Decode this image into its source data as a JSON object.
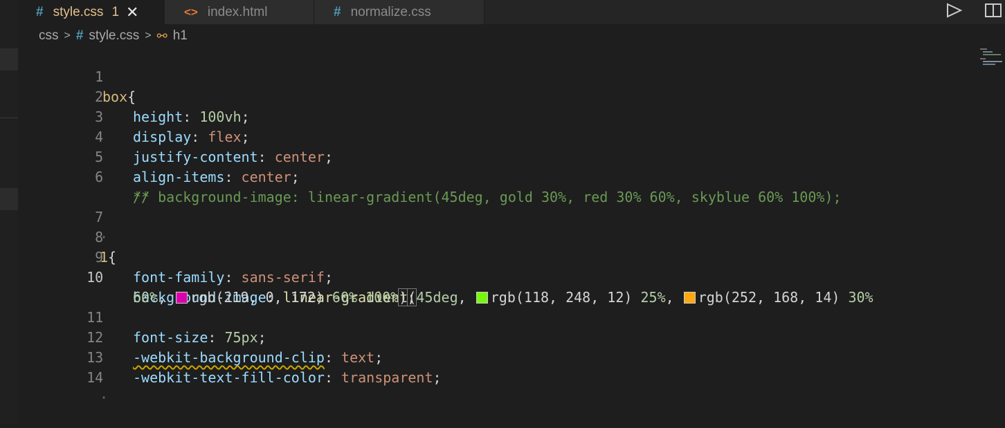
{
  "tabs": [
    {
      "icon": "#",
      "label": "style.css",
      "badge": "1",
      "close": "✕",
      "active": true
    },
    {
      "icon": "<>",
      "label": "index.html"
    },
    {
      "icon": "#",
      "label": "normalize.css"
    }
  ],
  "breadcrumb": {
    "folder": "css",
    "sep": ">",
    "file_icon": "#",
    "file": "style.css",
    "symbol_icon": "⚯",
    "symbol": "h1"
  },
  "lines": {
    "l1": "1",
    "l2": "2",
    "l3": "3",
    "l4": "4",
    "l5": "5",
    "l6": "6",
    "l7": "7",
    "l8": "8",
    "l9": "9",
    "l10": "10",
    "l11": "11",
    "l12": "12",
    "l13": "13",
    "l14": "14"
  },
  "code": {
    "l1_sel": "box",
    "l1_brace": "{",
    "l2_prop": "height",
    "l2_val": "100vh",
    "l3_prop": "display",
    "l3_val": "flex",
    "l4_prop": "justify-content",
    "l4_val": "center",
    "l5_prop": "align-items",
    "l5_val": "center",
    "l6_comment": "/* background-image: linear-gradient(45deg, gold 30%, red 30% 60%, skyblue 60% 100%);",
    "l6_cont": "*/",
    "l7_dot": "·",
    "l8_sel": "1",
    "l8_brace": "{",
    "l9_prop": "font-family",
    "l9_val": "sans-serif",
    "l10_prop": "background-image",
    "l10_fn": "linear-gradient",
    "l10_deg": "45deg",
    "l10_c1": "rgb(118, 248, 12)",
    "l10_p1": "25%",
    "l10_c2": "rgb(252, 168, 14)",
    "l10_p2": "30%",
    "l10_wrap": "60%",
    "l10_c3": "rgb(219, 0, 172)",
    "l10_p3": "60% 100%",
    "l11_prop": "font-size",
    "l11_val": "75px",
    "l12_prop": "-webkit-background-clip",
    "l12_val": "text",
    "l13_prop": "-webkit-text-fill-color",
    "l13_val": "transparent",
    "l14_dot": "·"
  },
  "colors": {
    "swatch1": "#76f80c",
    "swatch2": "#fca80e",
    "swatch3": "#db00ac"
  }
}
